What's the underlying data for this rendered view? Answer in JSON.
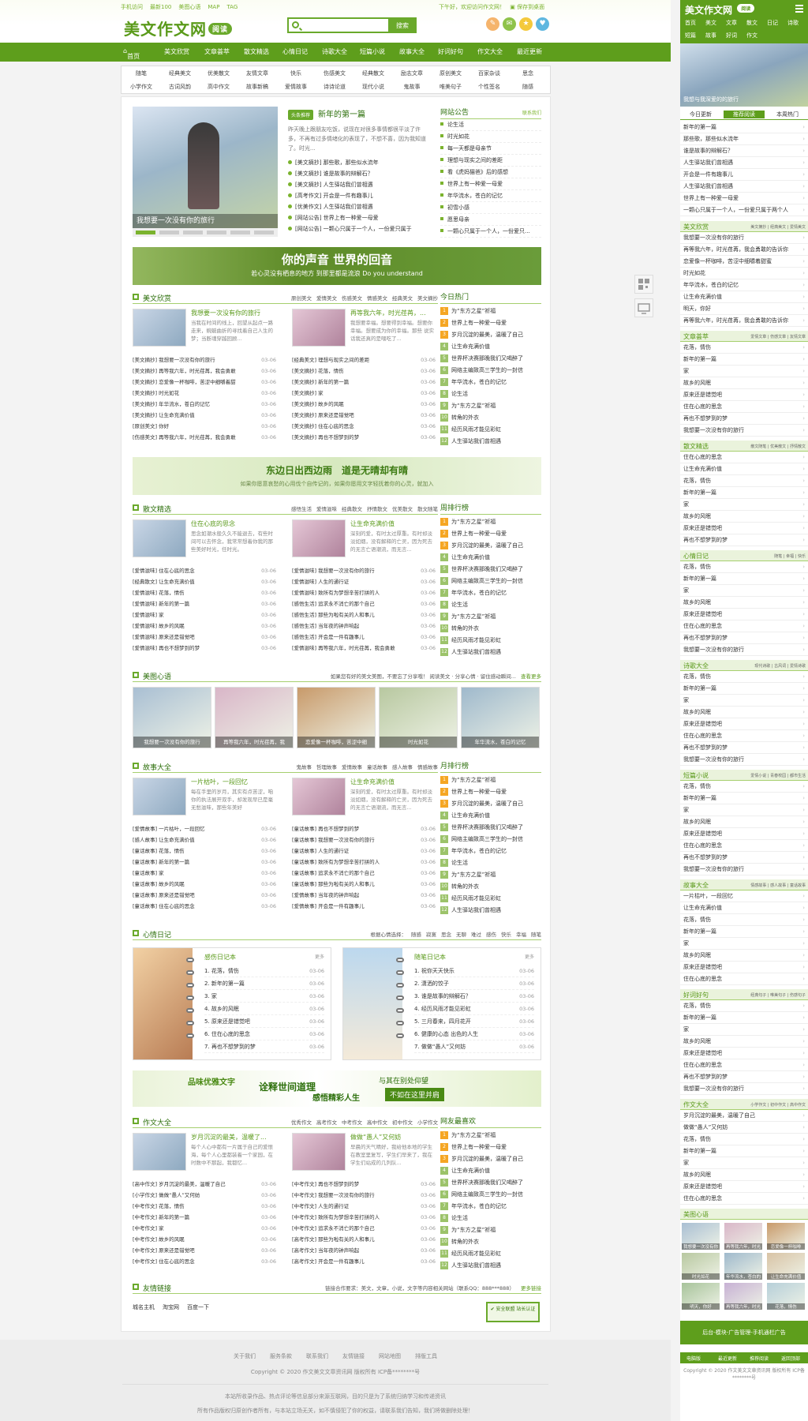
{
  "header": {
    "top_links": [
      "手机访问",
      "最新100",
      "美图心语",
      "MAP",
      "TAG"
    ],
    "top_right": "下午好，欢迎访问作文网！",
    "save_desktop": "保存到桌面",
    "logo": "美文作文网",
    "logo_badge": "阅读",
    "search_placeholder": "",
    "search_button": "搜索",
    "social_colors": [
      "#f5b46c",
      "#8fc34a",
      "#f4c93c",
      "#5fb7e0"
    ]
  },
  "nav": [
    "首页",
    "美文欣赏",
    "文章荟萃",
    "散文精选",
    "心情日记",
    "诗歌大全",
    "短篇小说",
    "故事大全",
    "好词好句",
    "作文大全",
    "最近更新"
  ],
  "subnav": [
    [
      "随笔",
      "经典美文",
      "优美散文",
      "友情文章",
      "快乐",
      "伤感美文",
      "经典散文",
      "励志文章",
      "原创美文",
      "百家杂谈",
      "思念"
    ],
    [
      "小学作文",
      "古词风韵",
      "高中作文",
      "故事新稿",
      "爱情故事",
      "诗诗论道",
      "现代小说",
      "鬼故事",
      "唯美句子",
      "个性签名",
      "随感"
    ]
  ],
  "hero": {
    "caption": "我想要一次没有你的旅行"
  },
  "featured": {
    "tag": "头条推荐",
    "title": "新年的第一篇",
    "summary": "昨天晚上跟朋友吃饭，说现在对很多事情都很平淡了许多，不再有过多情绪化的表现了，不想不喜，因为我知道了。时光...",
    "items": [
      "[美文摘抄] 那些歌，那些似水流年",
      "[美文摘抄] 谁是故事的辩解石？",
      "[美文摘抄] 人生驿站我们曾相遇",
      "[高考作文] 开会是一件有趣事儿",
      "[优美作文] 人生驿站我们曾相遇",
      "[网站公告] 世界上有一种爱一母爱",
      "[网站公告] 一颗心只属于一个人，一份爱只属于"
    ]
  },
  "notice": {
    "title": "网站公告",
    "more": "联系我们",
    "items": [
      "论生活",
      "时光如花",
      "每一天都是母亲节",
      "理想与现实之间的差距",
      "看《虎妈猫爸》后的感想",
      "世界上有一种爱一母爱",
      "年华流水，苍白的记忆",
      "初雪小感",
      "愿思母亲",
      "一颗心只属于一个人，一份爱只..."
    ]
  },
  "banner1": {
    "line1": "你的声音 世界的回音",
    "line2": "若心灵没有栖息的地方 到那里都是流浪 Do you understand"
  },
  "section_meiwen": {
    "title": "美文欣赏",
    "tabs": [
      "原创美文",
      "爱情美文",
      "伤感美文",
      "情感美文",
      "经典美文",
      "美文摘抄"
    ],
    "cards": [
      {
        "title": "我想要一次没有你的旅行",
        "summary": "当我在时间的线上，回望从起点一路走来，蜿蜒曲折的寻找着自己人生的梦；当断魂穿越回顾..."
      },
      {
        "title": "再等我六年，时光荏苒，...",
        "summary": "我想要幸福。想要得到幸福。想要你幸福。想要成为你的幸福。那些 说实话我还真的是喂吃了..."
      }
    ],
    "rows": [
      [
        "[美文摘抄] 我想要一次没有你的旅行",
        "03-06",
        "[经典美文] 理想与现实之间的差距",
        "03-06"
      ],
      [
        "[美文摘抄] 再等我六年，时光荏苒，我会勇敢",
        "03-06",
        "[美文摘抄] 花落，情伤",
        "03-06"
      ],
      [
        "[美文摘抄] 恋爱像一杯咖啡，苦涩中细嚼着甜",
        "03-06",
        "[美文摘抄] 新年的第一篇",
        "03-06"
      ],
      [
        "[美文摘抄] 时光如花",
        "03-06",
        "[美文摘抄] 家",
        "03-06"
      ],
      [
        "[美文摘抄] 年华流水，苍白的记忆",
        "03-06",
        "[美文摘抄] 故乡的风眠",
        "03-06"
      ],
      [
        "[美文摘抄] 让生命充满价值",
        "03-06",
        "[美文摘抄] 原来还是错觉吧",
        "03-06"
      ],
      [
        "[原创美文] 你好",
        "03-06",
        "[美文摘抄] 住在心底的思念",
        "03-06"
      ],
      [
        "[伤感美文] 再等我六年，时光荏苒，我会勇敢",
        "03-06",
        "[美文摘抄] 再也不想梦到的梦",
        "03-06"
      ]
    ]
  },
  "hot_today": {
    "title": "今日热门",
    "items": [
      "为“东方之星”祈福",
      "世界上有一种爱一母爱",
      "岁月沉淀的最美，温暖了自己",
      "让生命充满价值",
      "世界杯决赛那晚我们又喝醉了",
      "网络主编致高三学生的一封信",
      "年华流水，苍白的记忆",
      "论生活",
      "为“东方之星”祈福",
      "转角的外衣",
      "经历风雨才能见彩虹",
      "人生驿站我们曾相遇"
    ]
  },
  "banner2": {
    "line1": "东边日出西边雨　道是无晴却有晴",
    "line2": "如果你愿意哀愁的心用伐个自传记的，如果你愿用文字轻抚着你的心灵，就加入"
  },
  "section_sanwen": {
    "title": "散文精选",
    "tabs": [
      "感悟生活",
      "爱情滋味",
      "经典散文",
      "抒情散文",
      "优美散文",
      "散文随笔"
    ],
    "cards": [
      {
        "title": "住在心底的思念",
        "summary": "思念如潮水般久久不能退去，有些时间可以去怀念，我常常想着你我的那些美好时光，任时光。"
      },
      {
        "title": "让生命充满价值",
        "summary": "深刻的爱，有时太过厚重。有时却淡淡如烟，没有解释的亡灵，因为死去的无言亡语潮流，而无言..."
      }
    ],
    "rows": [
      [
        "[爱情滋味] 住在心底的思念",
        "03-06",
        "[爱情滋味] 我想要一次没有你的旅行",
        "03-06"
      ],
      [
        "[经典散文] 让生命充满价值",
        "03-06",
        "[爱情滋味] 人生的通行证",
        "03-06"
      ],
      [
        "[爱情滋味] 花落，情伤",
        "03-06",
        "[爱情滋味] 致所有为梦想辛苦打拼的人",
        "03-06"
      ],
      [
        "[爱情滋味] 新年的第一篇",
        "03-06",
        "[感悟生活] 追求永不消亡的那个自己",
        "03-06"
      ],
      [
        "[爱情滋味] 家",
        "03-06",
        "[感悟生活] 那些为啦有关的人和事儿",
        "03-06"
      ],
      [
        "[爱情滋味] 故乡的风眠",
        "03-06",
        "[感悟生活] 当年夜的钟声响起",
        "03-06"
      ],
      [
        "[爱情滋味] 原来还是错觉吧",
        "03-06",
        "[感悟生活] 开会是一件有趣事儿",
        "03-06"
      ],
      [
        "[爱情滋味] 再也不想梦到的梦",
        "03-06",
        "[爱情滋味] 再等我六年，时光荏苒，我会勇敢",
        "03-06"
      ]
    ]
  },
  "week_rank": {
    "title": "周排行榜",
    "items": [
      "为“东方之星”祈福",
      "世界上有一种爱一母爱",
      "岁月沉淀的最美，温暖了自己",
      "让生命充满价值",
      "世界杯决赛那晚我们又喝醉了",
      "网络主编致高三学生的一封信",
      "年华流水，苍白的记忆",
      "论生活",
      "为“东方之星”祈福",
      "转角的外衣",
      "经历风雨才能见彩虹",
      "人生驿站我们曾相遇"
    ]
  },
  "section_meitu": {
    "title": "美图心语",
    "desc": "如果您有好的美文美图，不要忘了分享哦！ 阅读美文 · 分享心情 · 留住感动瞬间...",
    "more": "查看更多",
    "items": [
      "我想要一次没有你的旅行",
      "再等我六年，时光荏苒，我",
      "恋爱像一杯咖啡，苦涩中细",
      "时光如花",
      "年华流水，苍白的记忆"
    ],
    "colors": [
      "#a9bfd3",
      "#d9b6c8",
      "#c89a6a",
      "#b8c8a0",
      "#9fb9cc"
    ]
  },
  "section_gushi": {
    "title": "故事大全",
    "tabs": [
      "鬼故事",
      "哲理故事",
      "爱情故事",
      "童话故事",
      "感人故事",
      "情感故事"
    ],
    "cards": [
      {
        "title": "一片枯叶，一段回忆",
        "summary": "每在手里的岁月，其实有点苦涩，咱你的执法展开双手，却发现早已是毫无愁滋味，那些年美好"
      },
      {
        "title": "让生命充满价值",
        "summary": "深刻的爱，有时太过厚重。有时却淡淡如烟，没有解释的亡灵，因为死去的无言亡语潮流，而无言..."
      }
    ],
    "rows": [
      [
        "[爱情故事] 一片枯叶，一段回忆",
        "03-06",
        "[童话故事] 再也不想梦到的梦",
        "03-06"
      ],
      [
        "[感人故事] 让生命充满价值",
        "03-06",
        "[童话故事] 我想要一次没有你的旅行",
        "03-06"
      ],
      [
        "[童话故事] 花落，情伤",
        "03-06",
        "[童话故事] 人生的通行证",
        "03-06"
      ],
      [
        "[童话故事] 新年的第一篇",
        "03-06",
        "[童话故事] 致所有为梦想辛苦打拼的人",
        "03-06"
      ],
      [
        "[童话故事] 家",
        "03-06",
        "[童话故事] 追求永不消亡的那个自己",
        "03-06"
      ],
      [
        "[童话故事] 故乡的风眠",
        "03-06",
        "[童话故事] 那些为啦有关的人和事儿",
        "03-06"
      ],
      [
        "[童话故事] 原来还是错觉吧",
        "03-06",
        "[爱情故事] 当年夜的钟声响起",
        "03-06"
      ],
      [
        "[童话故事] 住在心底的思念",
        "03-06",
        "[爱情故事] 开会是一件有趣事儿",
        "03-06"
      ]
    ]
  },
  "month_rank": {
    "title": "月排行榜",
    "items": [
      "为“东方之星”祈福",
      "世界上有一种爱一母爱",
      "岁月沉淀的最美，温暖了自己",
      "让生命充满价值",
      "世界杯决赛那晚我们又喝醉了",
      "网络主编致高三学生的一封信",
      "年华流水，苍白的记忆",
      "论生活",
      "为“东方之星”祈福",
      "转角的外衣",
      "经历风雨才能见彩虹",
      "人生驿站我们曾相遇"
    ]
  },
  "section_xinqing": {
    "title": "心情日记",
    "tabs_label": "根据心情选择：",
    "tabs": [
      "随感",
      "寂寞",
      "思念",
      "无聊",
      "难过",
      "感伤",
      "快乐",
      "幸福",
      "随笔"
    ],
    "diary": [
      {
        "title": "感伤日记本",
        "more": "更多",
        "items": [
          "1. 花落，情伤",
          "2. 新年的第一篇",
          "3. 家",
          "4. 故乡的风眠",
          "5. 原来还是错觉吧",
          "6. 住在心底的思念",
          "7. 再也不想梦到的梦"
        ]
      },
      {
        "title": "随笔日记本",
        "more": "更多",
        "items": [
          "1. 祝你天天快乐",
          "2. 潇洒的饺子",
          "3. 谁是故事的辩解石？",
          "4. 经历风雨才能见彩虹",
          "5. 三月春来，四月花开",
          "6. 健康的心态 出色的人生",
          "7. 做做“愚人”又何妨"
        ]
      }
    ],
    "date": "03-06"
  },
  "banner3": {
    "a": "品味优雅文字",
    "b": "诠释世间道理",
    "c": "感悟精彩人生",
    "d": "与其在别处仰望",
    "e": "不如在这里并肩"
  },
  "section_zuowen": {
    "title": "作文大全",
    "tabs": [
      "优秀作文",
      "高考作文",
      "中考作文",
      "高中作文",
      "初中作文",
      "小学作文"
    ],
    "cards": [
      {
        "title": "岁月沉淀的最美，温暖了...",
        "summary": "每个人心中都有一片属于自己的爱恨海，每个人心里都装着一个家园，在时数中不那起，我都忆..."
      },
      {
        "title": "做做“愚人”又何妨",
        "summary": "早晨的天气晴好，我给他本地的学生在教室里复写，学生们早来了，我在学生们站成的几列队..."
      }
    ],
    "rows": [
      [
        "[高中作文] 岁月沉淀的最美，温暖了自己",
        "03-06",
        "[中考作文] 再也不想梦到的梦",
        "03-06"
      ],
      [
        "[小学作文] 做做“愚人”又何妨",
        "03-06",
        "[中考作文] 我想要一次没有你的旅行",
        "03-06"
      ],
      [
        "[中考作文] 花落，情伤",
        "03-06",
        "[中考作文] 人生的通行证",
        "03-06"
      ],
      [
        "[中考作文] 新年的第一篇",
        "03-06",
        "[中考作文] 致所有为梦想辛苦打拼的人",
        "03-06"
      ],
      [
        "[中考作文] 家",
        "03-06",
        "[中考作文] 追求永不消亡的那个自己",
        "03-06"
      ],
      [
        "[中考作文] 故乡的风眠",
        "03-06",
        "[高考作文] 那些为啦有关的人和事儿",
        "03-06"
      ],
      [
        "[中考作文] 原来还是错觉吧",
        "03-06",
        "[高考作文] 当年夜的钟声响起",
        "03-06"
      ],
      [
        "[中考作文] 住在心底的思念",
        "03-06",
        "[高考作文] 开会是一件有趣事儿",
        "03-06"
      ]
    ]
  },
  "fav": {
    "title": "网友最喜欢",
    "items": [
      "为“东方之星”祈福",
      "世界上有一种爱一母爱",
      "岁月沉淀的最美，温暖了自己",
      "让生命充满价值",
      "世界杯决赛那晚我们又喝醉了",
      "网络主编致高三学生的一封信",
      "年华流水，苍白的记忆",
      "论生活",
      "为“东方之星”祈福",
      "转角的外衣",
      "经历风雨才能见彩虹",
      "人生驿站我们曾相遇"
    ]
  },
  "links": {
    "title": "友情链接",
    "desc": "链接合作要求：美文，文章，小说，文字等内容相关网站（联系QQ：888***888）",
    "more": "更多链接",
    "items": [
      "城名主机",
      "淘宝网",
      "百度一下"
    ],
    "badge": "安全联盟 站长认证"
  },
  "footer": {
    "links": [
      "关于我们",
      "服务条款",
      "联系我们",
      "友情链接",
      "网站地图",
      "排版工具"
    ],
    "copyright": "Copyright © 2020 作文美文文章资讯网 版权所有 ICP备********号",
    "note1": "本站所收录作品、热点评论等信息部分来源互联网，目的只是为了系统归纳学习和传递资讯",
    "note2": "所有作品版权归原创作者所有，与本站立场无关，如不慎侵犯了你的权益，请联系我们告知，我们将做删除处理！"
  },
  "mobile": {
    "logo": "美文作文网",
    "logo_badge": "阅读",
    "nav": [
      "首页",
      "美文",
      "文章",
      "散文",
      "日记",
      "诗歌",
      "短篇",
      "故事",
      "好词",
      "作文"
    ],
    "hero_caption": "我想与我深爱的的旅行",
    "tabs": [
      "今日更新",
      "推荐阅读",
      "本周热门"
    ],
    "today": [
      "新年的第一篇",
      "那些歌，那些似水流年",
      "谁是故事的辩解石？",
      "人生驿站我们曾相遇",
      "开会是一件有趣事儿",
      "人生驿站我们曾相遇",
      "世界上有一种爱一母爱",
      "一颗心只属于一个人，一份爱只属于两个人"
    ],
    "sections": [
      {
        "title": "美文欣赏",
        "sub": "美文摘抄 | 经典美文 | 爱情美文",
        "items": [
          "我想要一次没有你的旅行",
          "再等我六年，时光荏苒，我会勇敢的告诉你",
          "恋爱像一杯咖啡，苦涩中细嚼着甜蜜",
          "时光如花",
          "年华流水，苍白的记忆",
          "让生命充满价值",
          "明天，你好",
          "再等我六年，时光荏苒，我会勇敢的告诉你"
        ]
      },
      {
        "title": "文章荟萃",
        "sub": "爱情文章 | 伤感文章 | 友情文章",
        "items": [
          "花落，情伤",
          "新年的第一篇",
          "家",
          "故乡的风眠",
          "原来还是错觉吧",
          "住在心底的思念",
          "再也不想梦到的梦",
          "我想要一次没有你的旅行"
        ]
      },
      {
        "title": "散文精选",
        "sub": "散文随笔 | 优美散文 | 抒情散文",
        "items": [
          "住在心底的思念",
          "让生命充满价值",
          "花落，情伤",
          "新年的第一篇",
          "家",
          "故乡的风眠",
          "原来还是错觉吧",
          "再也不想梦到的梦"
        ]
      },
      {
        "title": "心情日记",
        "sub": "随笔 | 幸福 | 快乐",
        "items": [
          "花落，情伤",
          "新年的第一篇",
          "家",
          "故乡的风眠",
          "原来还是错觉吧",
          "住在心底的思念",
          "再也不想梦到的梦",
          "我想要一次没有你的旅行"
        ]
      },
      {
        "title": "诗歌大全",
        "sub": "现代诗歌 | 古风词 | 爱情诗歌",
        "items": [
          "花落，情伤",
          "新年的第一篇",
          "家",
          "故乡的风眠",
          "原来还是错觉吧",
          "住在心底的思念",
          "再也不想梦到的梦",
          "我想要一次没有你的旅行"
        ]
      },
      {
        "title": "短篇小说",
        "sub": "爱情小说 | 青春校园 | 都市生活",
        "items": [
          "花落，情伤",
          "新年的第一篇",
          "家",
          "故乡的风眠",
          "原来还是错觉吧",
          "住在心底的思念",
          "再也不想梦到的梦",
          "我想要一次没有你的旅行"
        ]
      },
      {
        "title": "故事大全",
        "sub": "情感故事 | 感人故事 | 童话故事",
        "items": [
          "一片枯叶，一段回忆",
          "让生命充满价值",
          "花落，情伤",
          "新年的第一篇",
          "家",
          "故乡的风眠",
          "原来还是错觉吧",
          "住在心底的思念"
        ]
      },
      {
        "title": "好词好句",
        "sub": "经典句子 | 唯美句子 | 伤感句子",
        "items": [
          "花落，情伤",
          "新年的第一篇",
          "家",
          "故乡的风眠",
          "原来还是错觉吧",
          "住在心底的思念",
          "再也不想梦到的梦",
          "我想要一次没有你的旅行"
        ]
      },
      {
        "title": "作文大全",
        "sub": "小学作文 | 初中作文 | 高中作文",
        "items": [
          "岁月沉淀的最美，温暖了自己",
          "做做“愚人”又何妨",
          "花落，情伤",
          "新年的第一篇",
          "家",
          "故乡的风眠",
          "原来还是错觉吧",
          "住在心底的思念"
        ]
      }
    ],
    "gallery_title": "美图心语",
    "gallery": [
      "我想要一次没有你",
      "再等我六年，时光",
      "恋爱像一杯咖啡",
      "时光如花",
      "年华流水，苍白的",
      "让生命充满价值",
      "明天，你好",
      "再等我六年，时光",
      "花落，情伤"
    ],
    "ad": "后台-模块-广告管理-手机通栏广告",
    "foot": [
      "电脑版",
      "最近更新",
      "推荐阅读",
      "返回顶部"
    ],
    "copyright": "Copyright © 2020 作文美文文章资讯网 版权所有 ICP备********号"
  }
}
